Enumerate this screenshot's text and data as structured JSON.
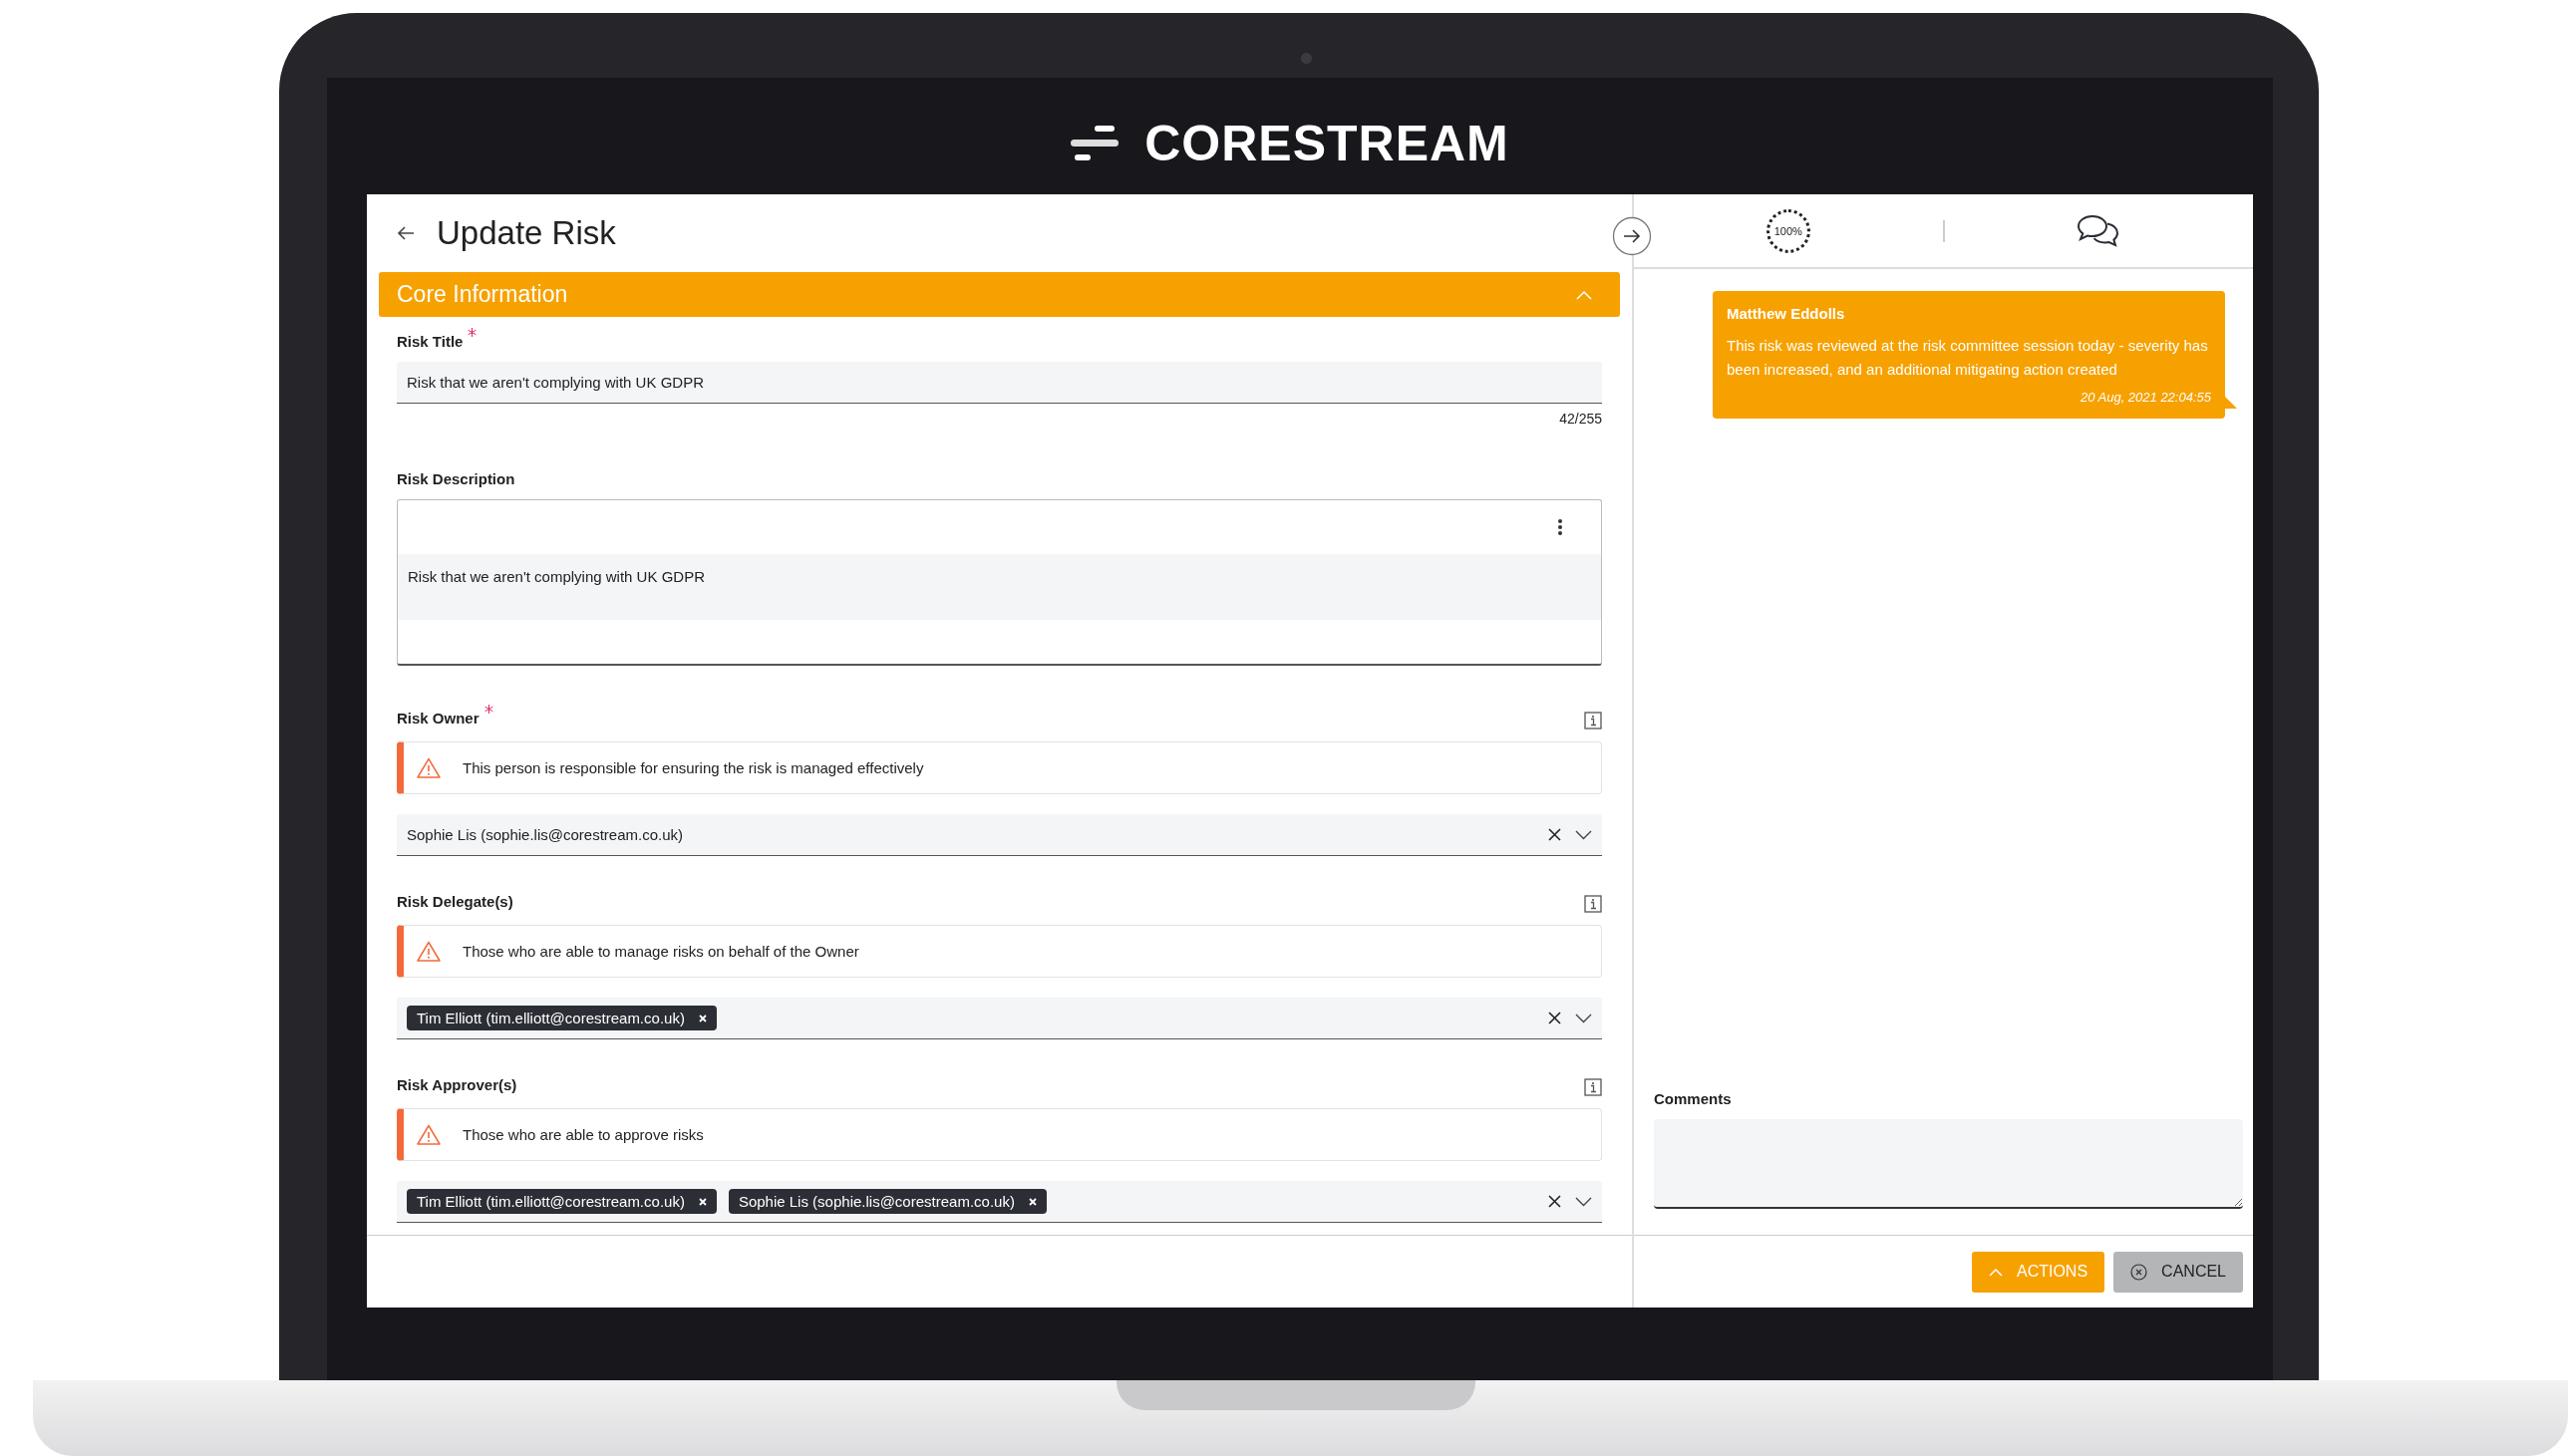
{
  "brand": {
    "logo_text": "CORESTREAM"
  },
  "page": {
    "title": "Update Risk"
  },
  "section": {
    "title": "Core Information",
    "expanded": true
  },
  "fields": [
    {
      "kind": "text",
      "label": "Risk Title",
      "required": true,
      "value": "Risk that we aren't complying with UK GDPR",
      "counter": "42/255"
    },
    {
      "kind": "richtext",
      "label": "Risk Description",
      "value": "Risk that we aren't complying with UK GDPR"
    },
    {
      "kind": "select",
      "label": "Risk Owner",
      "required": true,
      "hint": "This person is responsible for ensuring the risk is managed effectively",
      "value": "Sophie Lis (sophie.lis@corestream.co.uk)"
    },
    {
      "kind": "multiselect",
      "label": "Risk Delegate(s)",
      "hint": "Those who are able to manage risks on behalf of the Owner",
      "chips": [
        "Tim Elliott (tim.elliott@corestream.co.uk)"
      ]
    },
    {
      "kind": "multiselect",
      "label": "Risk Approver(s)",
      "hint": "Those who are able to approve risks",
      "chips": [
        "Tim Elliott (tim.elliott@corestream.co.uk)",
        "Sophie Lis (sophie.lis@corestream.co.uk)"
      ]
    }
  ],
  "side_panel": {
    "progress": "100%",
    "messages": [
      {
        "author": "Matthew Eddolls",
        "text": "This risk was reviewed at the risk committee session today - severity has been increased, and an additional mitigating action created",
        "time": "20 Aug, 2021 22:04:55"
      }
    ],
    "comments": {
      "label": "Comments"
    }
  },
  "footer": {
    "buttons": [
      {
        "kind": "primary",
        "label": "ACTIONS"
      },
      {
        "kind": "secondary",
        "label": "CANCEL"
      }
    ]
  }
}
